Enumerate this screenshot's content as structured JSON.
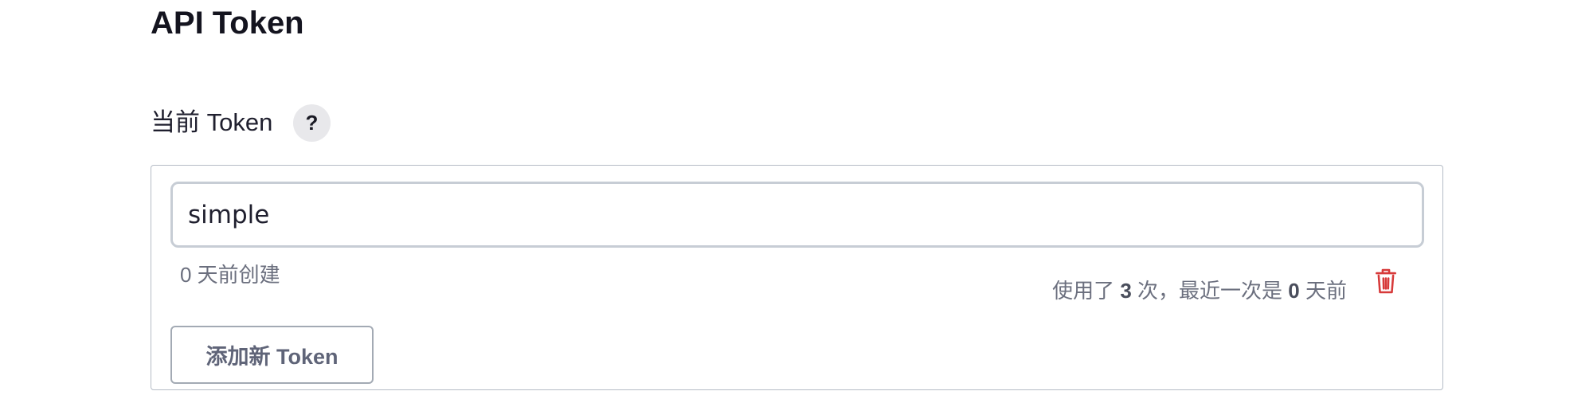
{
  "section": {
    "title": "API Token"
  },
  "current_tokens": {
    "label": "当前 Token",
    "help_label": "?"
  },
  "tokens": [
    {
      "name": "simple",
      "created": "0 天前创建",
      "usage_prefix": "使用了",
      "usage_count": "3",
      "usage_mid": "次，最近一次是",
      "last_used_days": "0",
      "usage_suffix": "天前"
    }
  ],
  "add_button": {
    "label": "添加新 Token"
  },
  "icons": {
    "help": "help-icon",
    "delete": "trash-icon"
  },
  "colors": {
    "delete": "#d73a3a",
    "border": "#b5bcc6",
    "muted_text": "#6b6f7e"
  }
}
